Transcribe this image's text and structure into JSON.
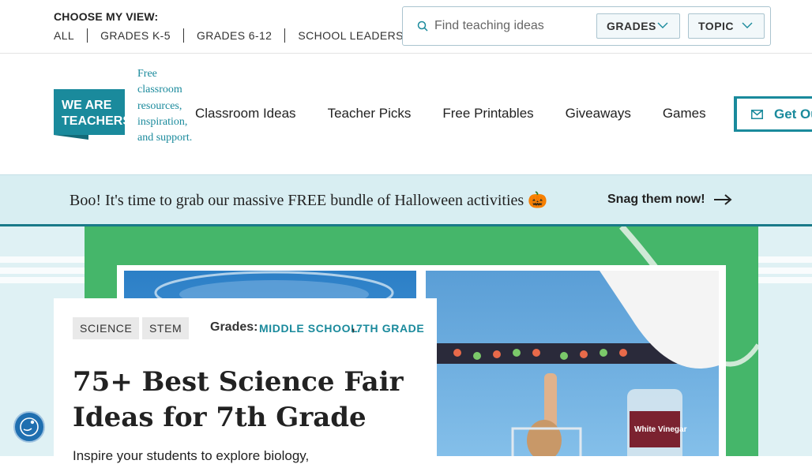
{
  "utility": {
    "choose_label": "CHOOSE MY VIEW:",
    "views": [
      "ALL",
      "GRADES K-5",
      "GRADES 6-12",
      "SCHOOL LEADERS"
    ]
  },
  "search": {
    "placeholder": "Find teaching ideas",
    "grades_label": "GRADES",
    "topic_label": "TOPIC"
  },
  "header": {
    "logo_text_line1": "WE ARE",
    "logo_text_line2": "TEACHERS",
    "tagline": "Free classroom resources, inspiration, and support.",
    "nav": [
      "Classroom Ideas",
      "Teacher Picks",
      "Free Printables",
      "Giveaways",
      "Games"
    ],
    "cta_label": "Get Our",
    "brand_color": "#1a8a9c"
  },
  "banner": {
    "text": "Boo! It's time to grab our massive FREE bundle of Halloween activities 🎃",
    "link_label": "Snag them now!"
  },
  "article": {
    "tags": [
      "SCIENCE",
      "STEM"
    ],
    "grades_label": "Grades:",
    "grades": [
      "MIDDLE SCHOOL",
      "7TH GRADE"
    ],
    "title": "75+ Best Science Fair Ideas for 7th Grade",
    "subtitle": "Inspire your students to explore biology,"
  },
  "photo": {
    "bottle_label": "White Vinegar"
  },
  "icons": [
    "search-icon",
    "chevron-down-icon",
    "mail-icon",
    "arrow-right-icon",
    "accessibility-icon"
  ]
}
